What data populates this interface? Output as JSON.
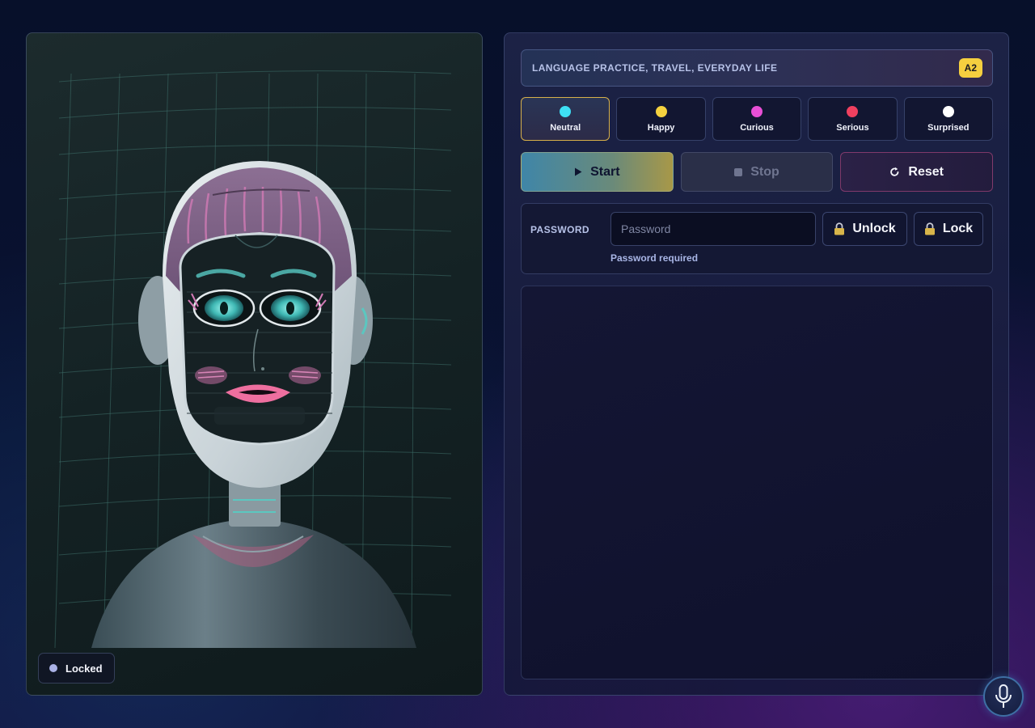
{
  "avatar": {
    "status_label": "Locked",
    "status_color": "#aab2e6"
  },
  "topic": {
    "text": "LANGUAGE PRACTICE, TRAVEL, EVERYDAY LIFE",
    "level": "A2"
  },
  "moods": [
    {
      "label": "Neutral",
      "color": "#3ee0f5",
      "active": true
    },
    {
      "label": "Happy",
      "color": "#f5d23f",
      "active": false
    },
    {
      "label": "Curious",
      "color": "#e84fd6",
      "active": false
    },
    {
      "label": "Serious",
      "color": "#f0405f",
      "active": false
    },
    {
      "label": "Surprised",
      "color": "#ffffff",
      "active": false
    }
  ],
  "actions": {
    "start_label": "Start",
    "stop_label": "Stop",
    "reset_label": "Reset"
  },
  "password": {
    "label": "PASSWORD",
    "placeholder": "Password",
    "value": "",
    "unlock_label": "Unlock",
    "lock_label": "Lock",
    "hint": "Password required"
  },
  "icons": {
    "start": "play-icon",
    "stop": "stop-icon",
    "reset": "refresh-icon",
    "lock": "padlock-icon",
    "mic": "microphone-icon"
  }
}
